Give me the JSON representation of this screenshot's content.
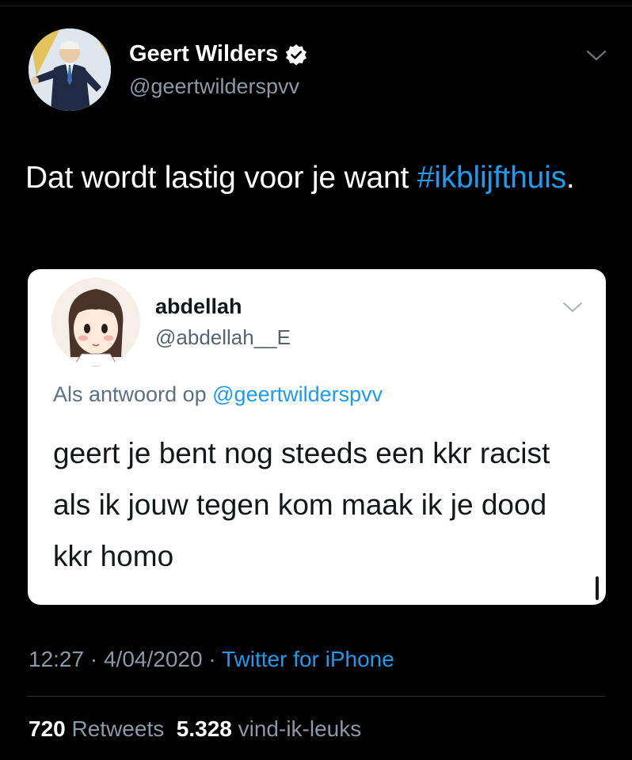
{
  "author": {
    "name": "Geert Wilders",
    "handle": "@geertwilderspvv",
    "verified_icon": "verified-badge-icon"
  },
  "tweet": {
    "text_plain": "Dat wordt lastig voor je want",
    "hashtag": "#ikblijfthuis",
    "trailing": "."
  },
  "quoted": {
    "name": "abdellah",
    "handle": "@abdellah__E",
    "reply_prefix": "Als antwoord op",
    "reply_mention": "@geertwilderspvv",
    "text": "geert je bent nog steeds een kkr racist als ik jouw tegen kom maak ik je dood kkr homo"
  },
  "meta": {
    "time": "12:27",
    "separator": "·",
    "date": "4/04/2020",
    "source": "Twitter for iPhone"
  },
  "stats": {
    "retweets_count": "720",
    "retweets_label": "Retweets",
    "likes_count": "5.328",
    "likes_label": "vind-ik-leuks"
  },
  "colors": {
    "background": "#000000",
    "link": "#1d9bf0",
    "muted": "#8b98a5"
  }
}
